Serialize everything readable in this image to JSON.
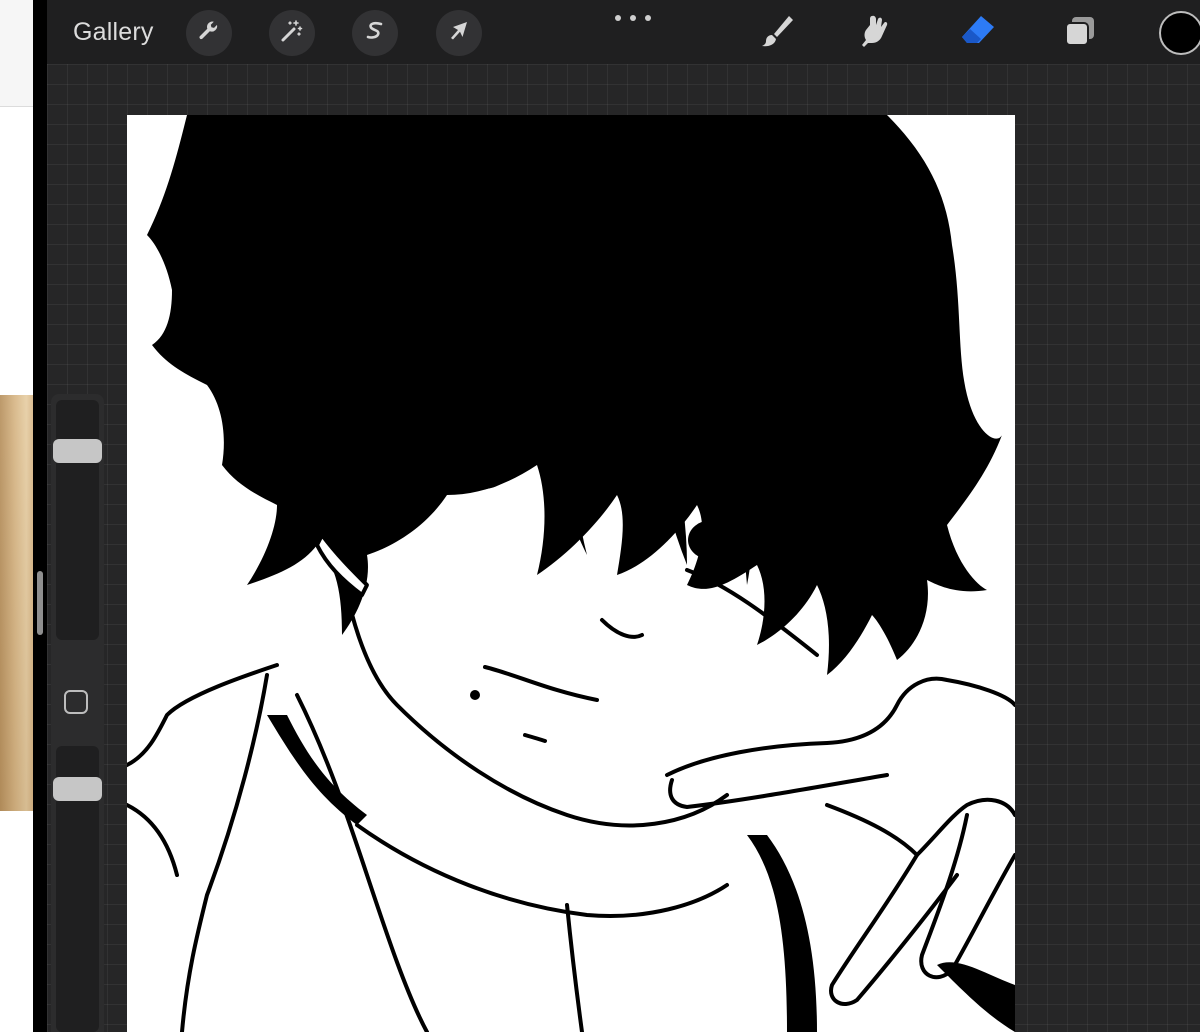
{
  "toolbar": {
    "gallery_label": "Gallery",
    "left_tools": [
      {
        "name": "actions",
        "icon": "wrench-icon"
      },
      {
        "name": "adjustments",
        "icon": "magic-wand-icon"
      },
      {
        "name": "selection",
        "icon": "selection-s-icon"
      },
      {
        "name": "transform",
        "icon": "arrow-cursor-icon"
      }
    ],
    "more_icon": "ellipsis-icon",
    "right_tools": [
      {
        "name": "brush",
        "icon": "brush-icon",
        "active": false
      },
      {
        "name": "smudge",
        "icon": "smudge-icon",
        "active": false
      },
      {
        "name": "eraser",
        "icon": "eraser-icon",
        "active": true
      },
      {
        "name": "layers",
        "icon": "layers-icon",
        "active": false
      }
    ],
    "current_color": "#000000"
  },
  "sidebar": {
    "brush_size_level": 0.18,
    "opacity_level": 0.12,
    "modify_button_icon": "square-icon"
  },
  "colors": {
    "accent": "#2d7bf6",
    "toolbar_bg": "#1f1f20",
    "workspace_bg": "#262627",
    "canvas_bg": "#ffffff"
  }
}
